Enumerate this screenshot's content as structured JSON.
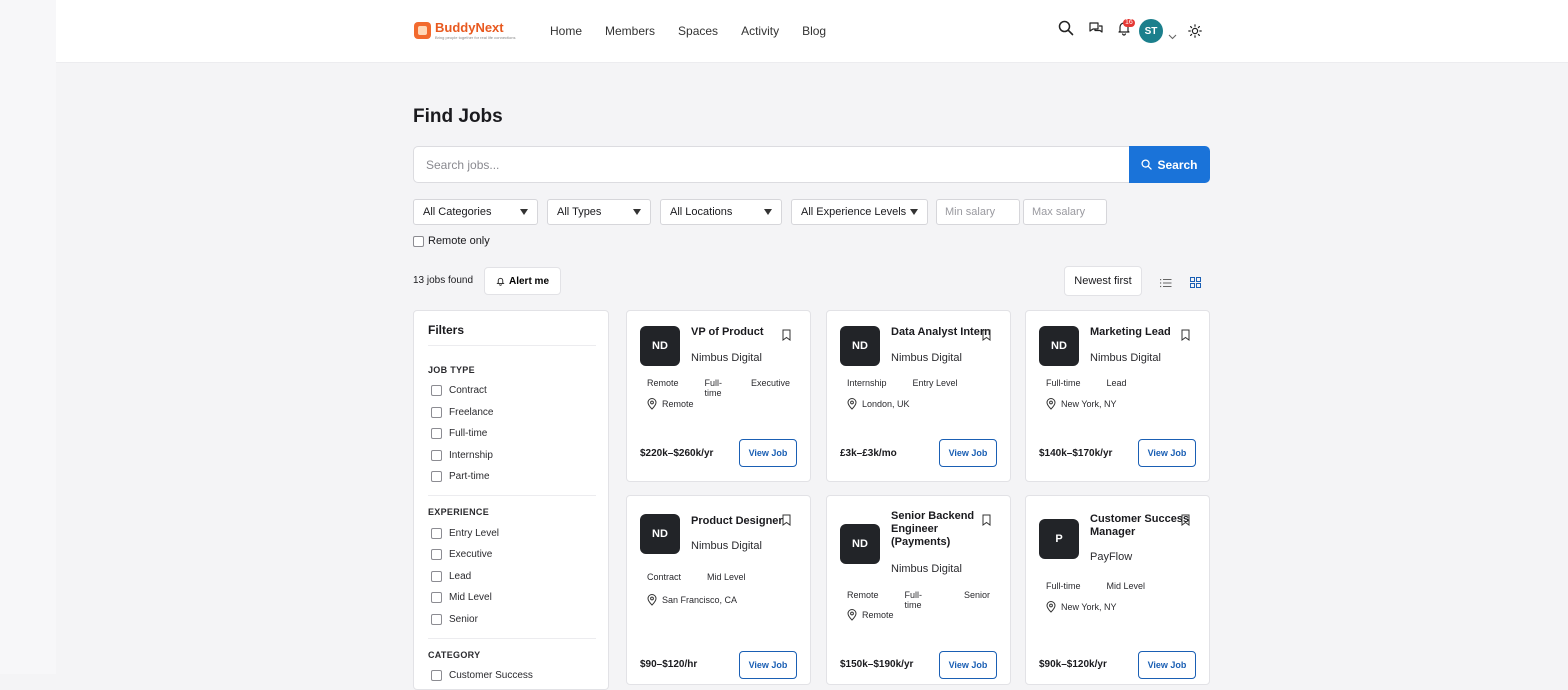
{
  "brand": {
    "name": "BuddyNext",
    "tagline": "Bring people together for real life connections"
  },
  "nav": [
    "Home",
    "Members",
    "Spaces",
    "Activity",
    "Blog"
  ],
  "header": {
    "notification_count": "16",
    "avatar_initials": "ST"
  },
  "page": {
    "title": "Find Jobs"
  },
  "search": {
    "placeholder": "Search jobs...",
    "value": "",
    "button_label": "Search"
  },
  "filters_bar": {
    "category": "All Categories",
    "type": "All Types",
    "location": "All Locations",
    "experience": "All Experience Levels",
    "min_salary_placeholder": "Min salary",
    "max_salary_placeholder": "Max salary",
    "remote_only_label": "Remote only"
  },
  "results": {
    "count_text": "13 jobs found",
    "alert_label": "Alert me",
    "sort_label": "Newest first"
  },
  "sidebar": {
    "title": "Filters",
    "job_type": {
      "heading": "JOB TYPE",
      "options": [
        "Contract",
        "Freelance",
        "Full-time",
        "Internship",
        "Part-time"
      ]
    },
    "experience": {
      "heading": "EXPERIENCE",
      "options": [
        "Entry Level",
        "Executive",
        "Lead",
        "Mid Level",
        "Senior"
      ]
    },
    "category": {
      "heading": "CATEGORY",
      "options": [
        "Customer Success"
      ]
    }
  },
  "jobs": [
    {
      "initials": "ND",
      "title": "VP of Product",
      "company": "Nimbus Digital",
      "tags": [
        "Remote",
        "Full-time",
        "Executive"
      ],
      "location": "Remote",
      "salary": "$220k–$260k/yr",
      "button": "View Job"
    },
    {
      "initials": "ND",
      "title": "Data Analyst Intern",
      "company": "Nimbus Digital",
      "tags": [
        "Internship",
        "Entry Level"
      ],
      "location": "London, UK",
      "salary": "£3k–£3k/mo",
      "button": "View Job"
    },
    {
      "initials": "ND",
      "title": "Marketing Lead",
      "company": "Nimbus Digital",
      "tags": [
        "Full-time",
        "Lead"
      ],
      "location": "New York, NY",
      "salary": "$140k–$170k/yr",
      "button": "View Job"
    },
    {
      "initials": "ND",
      "title": "Product Designer",
      "company": "Nimbus Digital",
      "tags": [
        "Contract",
        "Mid Level"
      ],
      "location": "San Francisco, CA",
      "salary": "$90–$120/hr",
      "button": "View Job"
    },
    {
      "initials": "ND",
      "title": "Senior Backend Engineer (Payments)",
      "company": "Nimbus Digital",
      "tags": [
        "Remote",
        "Full-time",
        "Senior"
      ],
      "location": "Remote",
      "salary": "$150k–$190k/yr",
      "button": "View Job"
    },
    {
      "initials": "P",
      "title": "Customer Success Manager",
      "company": "PayFlow",
      "tags": [
        "Full-time",
        "Mid Level"
      ],
      "location": "New York, NY",
      "salary": "$90k–$120k/yr",
      "button": "View Job"
    }
  ]
}
